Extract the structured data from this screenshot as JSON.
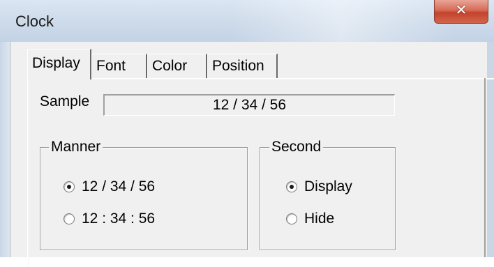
{
  "window": {
    "title": "Clock"
  },
  "tabs": [
    {
      "label": "Display",
      "active": true
    },
    {
      "label": "Font",
      "active": false
    },
    {
      "label": "Color",
      "active": false
    },
    {
      "label": "Position",
      "active": false
    }
  ],
  "sample": {
    "label": "Sample",
    "value": "12 / 34 / 56"
  },
  "manner": {
    "legend": "Manner",
    "options": [
      {
        "label": "12 / 34 / 56",
        "checked": true
      },
      {
        "label": "12 : 34 : 56",
        "checked": false
      }
    ]
  },
  "second": {
    "legend": "Second",
    "options": [
      {
        "label": "Display",
        "checked": true
      },
      {
        "label": "Hide",
        "checked": false
      }
    ]
  },
  "colors": {
    "titlebar": "#cfdceb",
    "close_button": "#c4432d",
    "dialog_face": "#f0f0f0"
  },
  "icons": {
    "close": "close-icon"
  }
}
